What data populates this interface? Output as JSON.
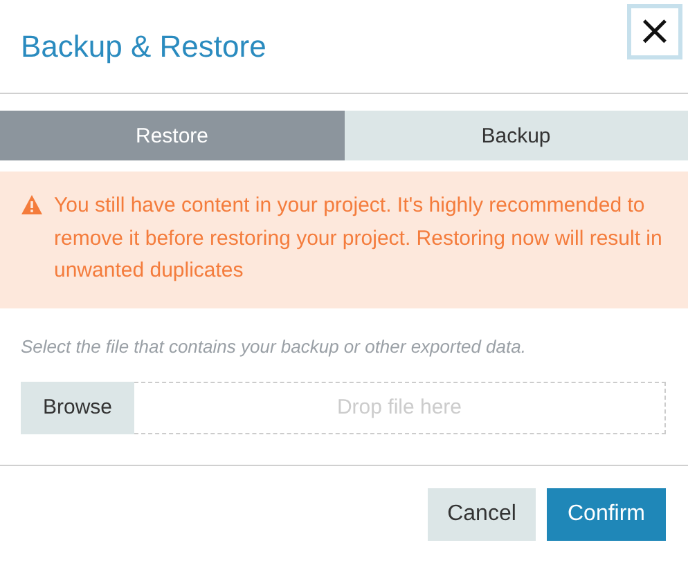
{
  "dialog": {
    "title": "Backup & Restore",
    "close": "×"
  },
  "tabs": [
    {
      "label": "Restore",
      "selected": true
    },
    {
      "label": "Backup",
      "selected": false
    }
  ],
  "warning": {
    "text": "You still have content in your project. It's highly recommended to remove it before restoring your project. Restoring now will result in unwanted duplicates"
  },
  "hint": "Select the file that contains your backup or other exported data.",
  "file_input": {
    "button": "Browse",
    "placeholder": "Drop file here"
  },
  "buttons": [
    {
      "label": "Cancel",
      "kind": "secondary"
    },
    {
      "label": "Confirm",
      "kind": "primary"
    }
  ]
}
